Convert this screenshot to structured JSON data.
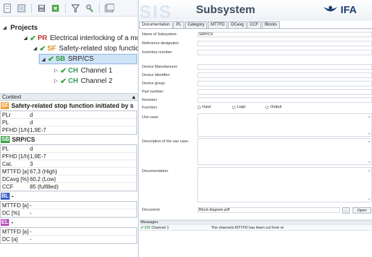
{
  "toolbar": {
    "icons": [
      "new-icon",
      "open-icon",
      "save-icon",
      "export-icon",
      "filter-icon",
      "search-person-icon",
      "library-icon"
    ]
  },
  "tree": {
    "root_label": "Projects",
    "project": {
      "code": "PR",
      "label": "Electrical interlocking of a mov"
    },
    "function": {
      "code": "SF",
      "label": "Safety-related stop functic"
    },
    "subsystem": {
      "code": "SB",
      "label": "SRP/CS"
    },
    "channels": [
      {
        "code": "CH",
        "label": "Channel 1"
      },
      {
        "code": "CH",
        "label": "Channel 2"
      }
    ]
  },
  "context": {
    "title": "Context",
    "function_section": {
      "code": "SF",
      "title": "Safety-related stop function initiated by s",
      "rows": [
        {
          "key": "PLr",
          "value": "d"
        },
        {
          "key": "PL",
          "value": "d"
        },
        {
          "key": "PFHD [1/h]",
          "value": "1,9E-7"
        }
      ]
    },
    "subsystem_section": {
      "code": "SB",
      "title": "SRP/CS",
      "rows": [
        {
          "key": "PL",
          "value": "d"
        },
        {
          "key": "PFHD [1/h]",
          "value": "1,9E-7"
        },
        {
          "key": "Cat.",
          "value": "3"
        },
        {
          "key": "MTTFD [a]",
          "value": "67,3 (High)"
        },
        {
          "key": "DCavg [%]",
          "value": "60,2 (Low)"
        },
        {
          "key": "CCF",
          "value": "85 (fulfilled)"
        }
      ]
    },
    "bl_section": {
      "code": "BL",
      "title": "-",
      "rows": [
        {
          "key": "MTTFD [a]",
          "value": "-"
        },
        {
          "key": "DC [%]",
          "value": "-"
        }
      ]
    },
    "el_section": {
      "code": "EL",
      "title": "-",
      "rows": [
        {
          "key": "MTTFD [a]",
          "value": "-"
        },
        {
          "key": "DC [a]",
          "value": "-"
        }
      ]
    }
  },
  "banner": {
    "watermark": "SIS",
    "title": "Subsystem",
    "logo_text": "IFA",
    "brand_color": "#1d3e73"
  },
  "tabs": [
    {
      "label": "Documentation",
      "active": true
    },
    {
      "label": "PL",
      "active": false
    },
    {
      "label": "Category",
      "active": false
    },
    {
      "label": "MTTFD",
      "active": false
    },
    {
      "label": "DCavg",
      "active": false
    },
    {
      "label": "CCF",
      "active": false
    },
    {
      "label": "Blocks",
      "active": false
    }
  ],
  "form": {
    "name_label": "Name of Subsystem:",
    "name_value": "SRP/CS",
    "reference_label": "Reference designator:",
    "inventory_label": "Inventory number:",
    "manufacturer_label": "Device Manufacturer:",
    "identifier_label": "Device Identifier:",
    "group_label": "Device group:",
    "part_label": "Part number:",
    "revision_label": "Revision:",
    "function_label": "Function:",
    "function_options": [
      "Input",
      "Logic",
      "Output"
    ],
    "use_case_label": "Use case:",
    "description_label": "Description of the use case:",
    "documentation_label": "Documentation:",
    "document_label": "Document:",
    "document_value": "Block-diagram.pdf",
    "browse_label": "...",
    "open_label": "Open"
  },
  "messages": {
    "title": "Messages",
    "items": [
      {
        "code": "CH",
        "source": "Channel 1",
        "text": "The channels MTTFD has been cut from or"
      }
    ]
  }
}
